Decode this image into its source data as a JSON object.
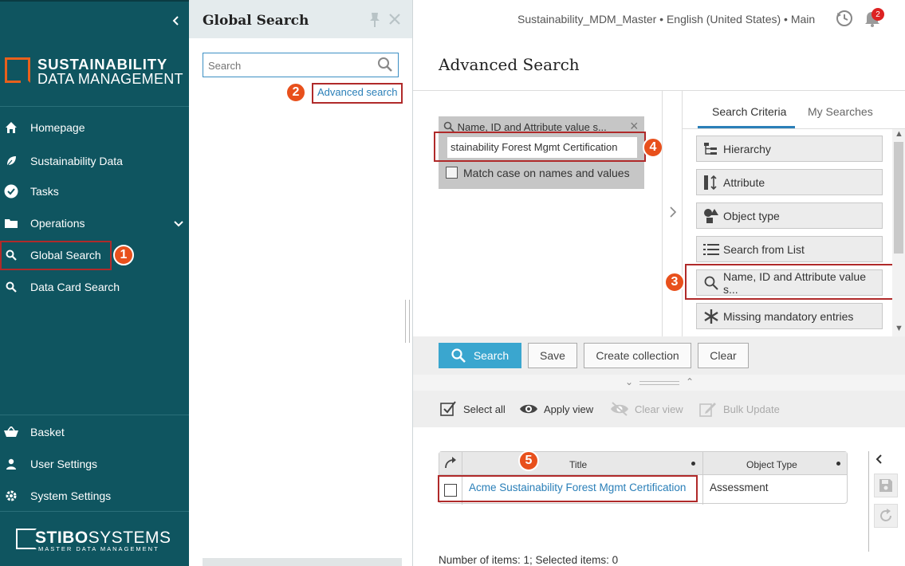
{
  "sidebar": {
    "brand_line1": "SUSTAINABILITY",
    "brand_line2": "DATA MANAGEMENT",
    "items": [
      {
        "label": "Homepage",
        "icon": "home-icon"
      },
      {
        "label": "Sustainability Data",
        "icon": "leaf-icon"
      },
      {
        "label": "Tasks",
        "icon": "check-circle-icon"
      },
      {
        "label": "Operations",
        "icon": "folder-icon"
      },
      {
        "label": "Global Search",
        "icon": "search-icon"
      },
      {
        "label": "Data Card Search",
        "icon": "search-icon"
      }
    ],
    "bottom_items": [
      {
        "label": "Basket",
        "icon": "basket-icon"
      },
      {
        "label": "User Settings",
        "icon": "user-icon"
      },
      {
        "label": "System Settings",
        "icon": "gear-icon"
      }
    ],
    "footer_brand_bold": "STIBO",
    "footer_brand_light": "SYSTEMS",
    "footer_tagline": "MASTER DATA MANAGEMENT"
  },
  "global_search": {
    "title": "Global Search",
    "placeholder": "Search",
    "advanced_link": "Advanced search"
  },
  "header": {
    "context": "Sustainability_MDM_Master • English (United States) • Main",
    "notification_count": "2"
  },
  "advanced": {
    "title": "Advanced Search",
    "criterion_header": "Name, ID and Attribute value s...",
    "criterion_value": "stainability Forest Mgmt Certification",
    "match_case_label": "Match case on names and values",
    "tabs": [
      "Search Criteria",
      "My Searches"
    ],
    "criteria_buttons": [
      {
        "label": "Hierarchy",
        "icon": "hierarchy-icon"
      },
      {
        "label": "Attribute",
        "icon": "attribute-icon"
      },
      {
        "label": "Object type",
        "icon": "object-type-icon"
      },
      {
        "label": "Search from List",
        "icon": "list-icon"
      },
      {
        "label": "Name, ID and Attribute value s...",
        "icon": "search-icon"
      },
      {
        "label": "Missing mandatory entries",
        "icon": "asterisk-icon"
      }
    ],
    "buttons": {
      "search": "Search",
      "save": "Save",
      "create_collection": "Create collection",
      "clear": "Clear"
    }
  },
  "results": {
    "toolbar": {
      "select_all": "Select all",
      "apply_view": "Apply view",
      "clear_view": "Clear view",
      "bulk_update": "Bulk Update"
    },
    "columns": [
      "Title",
      "Object Type"
    ],
    "rows": [
      {
        "title": "Acme Sustainability Forest Mgmt Certification",
        "type": "Assessment"
      }
    ],
    "summary": "Number of items: 1; Selected items: 0"
  },
  "badges": [
    "1",
    "2",
    "3",
    "4",
    "5"
  ],
  "colors": {
    "sidebar": "#0f5560",
    "accent": "#3aa6cf",
    "highlight": "#b02a2a",
    "badge": "#e8501c"
  }
}
